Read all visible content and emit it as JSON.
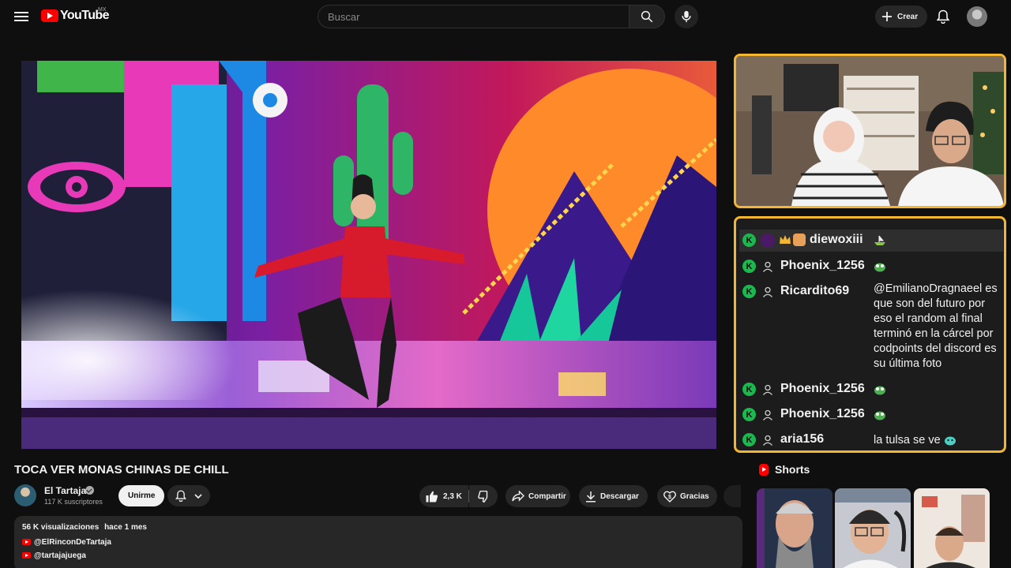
{
  "masthead": {
    "logo_text": "YouTube",
    "country": "MX",
    "search_placeholder": "Buscar",
    "create_label": "Crear",
    "icons": [
      "menu-icon",
      "search-icon",
      "microphone-icon",
      "plus-icon",
      "bell-icon"
    ]
  },
  "video": {
    "title": "TOCA VER MONAS CHINAS DE CHILL",
    "channel": {
      "name": "El Tartaja",
      "subscribers": "117 K suscriptores",
      "join_label": "Unirme"
    },
    "actions": {
      "likes": "2,3 K",
      "share": "Compartir",
      "download": "Descargar",
      "thanks": "Gracias"
    },
    "description": {
      "views": "56 K visualizaciones",
      "date": "hace 1 mes",
      "links": [
        "@ElRinconDeTartaja",
        "@tartajajuega"
      ]
    }
  },
  "chat": {
    "messages": [
      {
        "user": "diewoxiii",
        "text": "",
        "highlight": true
      },
      {
        "user": "Phoenix_1256",
        "text": ""
      },
      {
        "user": "Ricardito69",
        "text": "@EmilianoDragnaeel es que son del futuro por eso el random al final terminó en la cárcel por codpoints del discord es su última foto"
      },
      {
        "user": "Phoenix_1256",
        "text": ""
      },
      {
        "user": "Phoenix_1256",
        "text": ""
      },
      {
        "user": "aria156",
        "text": "la tulsa se ve"
      }
    ],
    "badge_letter": "K",
    "accent": "#f2b632",
    "badge_color": "#1bb84f"
  },
  "shorts": {
    "title": "Shorts"
  },
  "colors": {
    "background": "#0f0f0f",
    "surface": "#272727",
    "brand_red": "#ff0000",
    "text": "#f1f1f1",
    "muted": "#aaaaaa"
  }
}
